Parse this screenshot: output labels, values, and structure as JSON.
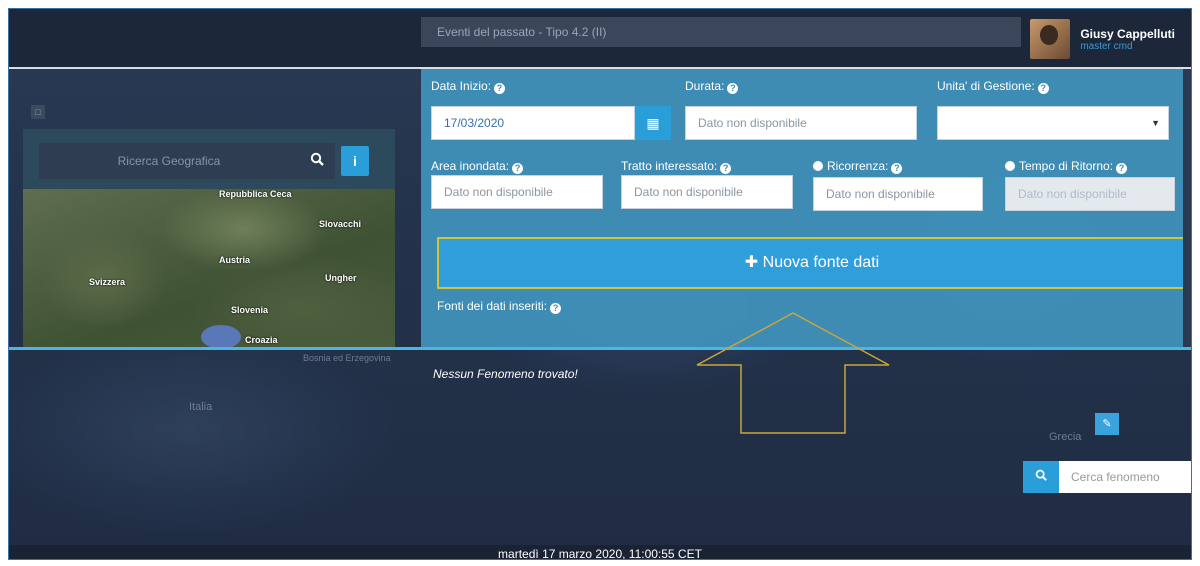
{
  "header": {
    "tab_title": "Eventi del passato - Tipo 4.2 (II)",
    "user_name": "Giusy Cappelluti",
    "user_role": "master cmd"
  },
  "left_panel": {
    "search_placeholder": "Ricerca Geografica",
    "info_label": "i",
    "map_labels": [
      "Repubblica Ceca",
      "Slovacchi",
      "Austria",
      "Svizzera",
      "Ungher",
      "Slovenia",
      "Croazia"
    ]
  },
  "form": {
    "data_inizio_label": "Data Inizio:",
    "data_inizio_value": "17/03/2020",
    "durata_label": "Durata:",
    "durata_placeholder": "Dato non disponibile",
    "unita_label": "Unita' di Gestione:",
    "unita_value": "",
    "area_label": "Area inondata:",
    "area_placeholder": "Dato non disponibile",
    "tratto_label": "Tratto interessato:",
    "tratto_placeholder": "Dato non disponibile",
    "ricorrenza_label": "Ricorrenza:",
    "ricorrenza_placeholder": "Dato non disponibile",
    "tempo_label": "Tempo di Ritorno:",
    "tempo_placeholder": "Dato non disponibile",
    "nuova_fonte_label": "Nuova fonte dati",
    "fonti_label": "Fonti dei dati inseriti:"
  },
  "map": {
    "nessun_label": "Nessun Fenomeno trovato!",
    "labels": [
      "Italia",
      "Grecia",
      "Bosnia ed Erzegovina",
      "Erzegovina"
    ],
    "search_placeholder": "Cerca fenomeno"
  },
  "status": {
    "datetime": "martedì 17 marzo 2020, 11:00:55 CET"
  },
  "colors": {
    "accent": "#2a9ed8",
    "panel": "#3f8fb8",
    "highlight_border": "#d4c43a"
  }
}
